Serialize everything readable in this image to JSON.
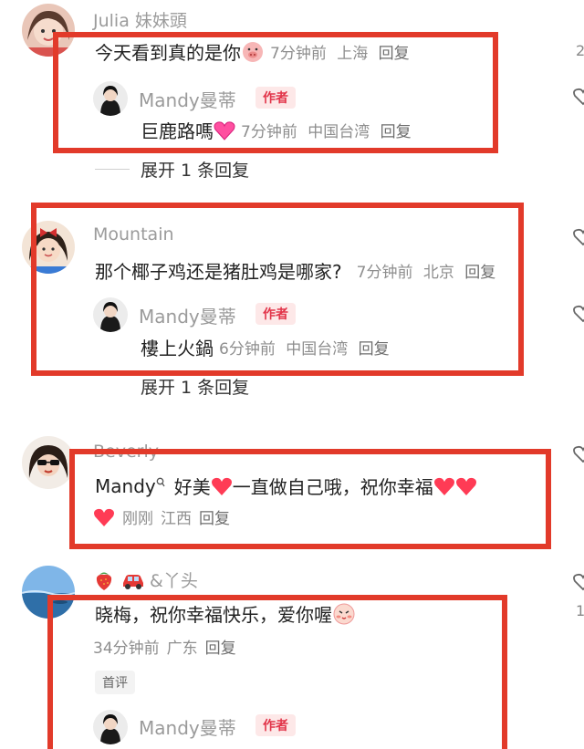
{
  "comments": [
    {
      "user": "Julia 妹妹頭",
      "text": "今天看到真的是你",
      "emoji": "pig-face-emoji",
      "time": "7分钟前",
      "location": "上海",
      "reply_label": "回复",
      "reply": {
        "user": "Mandy曼蒂",
        "badge": "作者",
        "text": "巨鹿路嗎",
        "emoji": "pink-heart-emoji",
        "time": "7分钟前",
        "location": "中国台湾",
        "reply_label": "回复"
      },
      "expand": "展开 1 条回复"
    },
    {
      "user": "Mountain",
      "text": "那个椰子鸡还是猪肚鸡是哪家?",
      "time": "7分钟前",
      "location": "北京",
      "reply_label": "回复",
      "reply": {
        "user": "Mandy曼蒂",
        "badge": "作者",
        "text": "樓上火鍋",
        "time": "6分钟前",
        "location": "中国台湾",
        "reply_label": "回复"
      },
      "expand": "展开 1 条回复"
    },
    {
      "user": "Beverly",
      "mention": "Mandy",
      "text_a": "好美",
      "text_b": "一直做自己哦，祝你幸福",
      "time": "刚刚",
      "location": "江西",
      "reply_label": "回复"
    },
    {
      "user": "&丫头",
      "text": "晓梅，祝你幸福快乐，爱你喔",
      "time": "34分钟前",
      "location": "广东",
      "reply_label": "回复",
      "tag": "首评",
      "reply": {
        "user": "Mandy曼蒂",
        "badge": "作者"
      }
    }
  ],
  "edge_digits": [
    "2",
    "1"
  ],
  "colors": {
    "highlight_border": "#e23a2a",
    "badge_bg": "#fde8e8",
    "badge_text": "#e2354a",
    "meta_text": "#8e8e8e",
    "username_text": "#9b9b9b"
  }
}
